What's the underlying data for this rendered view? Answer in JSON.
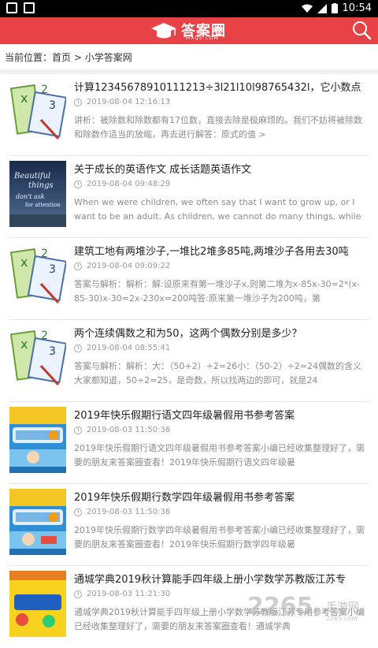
{
  "status_bar": {
    "time": "10:54",
    "icons": [
      "square-icon",
      "image-icon",
      "wifi-icon",
      "signal-icon",
      "battery-icon"
    ]
  },
  "header": {
    "logo_text": "答案圈",
    "logo_domain": "MXQE.COM",
    "search_icon": "search-icon",
    "accent_color": "#e84246"
  },
  "breadcrumb": {
    "prefix": "当前位置：",
    "home": "首页",
    "separator": " > ",
    "current": "小学答案网"
  },
  "items": [
    {
      "title": "计算12345678910111213÷3l21l10l98765432l，它小数点",
      "time": "2019-08-04 12:16:13",
      "desc": "讲析：被除数和除数都有17位数，直接去除是极麻烦的。我们不妨将被除数和除数作适当的放缩，再去进行解答：原式的值 >",
      "thumb": "math-notebook"
    },
    {
      "title": "关于成长的英语作文 成长话题英语作文",
      "time": "2019-08-04 09:48:29",
      "desc": "When we were children, we often say that I want to grow up, or I want to be an adult. As children, we cannot do many things, while",
      "thumb": "beautiful-things"
    },
    {
      "title": "建筑工地有两堆沙子,一堆比2堆多85吨,两堆沙子各用去30吨",
      "time": "2019-08-04 09:09:22",
      "desc": "答案与解析：解析：解:设原来有第一堆沙子x,则第二堆为x-85x-30=2*(x-85-30)x-30=2x-230x=200吨答:原来第一堆沙子为200吨，第",
      "thumb": "math-notebook"
    },
    {
      "title": "两个连续偶数之和为50，这两个偶数分别是多少？",
      "time": "2019-08-04 08:55:41",
      "desc": "答案与解析：解析：大：（50+2）÷2=26小：（50-2）÷2=24偶数的含义大家都知道，50÷2=25，是奇数，所以找两边的即可，就是24",
      "thumb": "math-notebook"
    },
    {
      "title": "2019年快乐假期行语文四年级暑假用书参考答案",
      "time": "2019-08-03 11:50:36",
      "desc": "2019年快乐假期行语文四年级暑假用书参考答案小编已经收集整理好了，需要的朋友来答案圈查看！2019年快乐假期行语文四年级暑",
      "thumb": "holiday-book"
    },
    {
      "title": "2019年快乐假期行数学四年级暑假用书参考答案",
      "time": "2019-08-03 11:50:36",
      "desc": "2019年快乐假期行数学四年级暑假用书参考答案小编已经收集整理好了，需要的朋友来答案圈查看！2019年快乐假期行数学四年级暑",
      "thumb": "holiday-book"
    },
    {
      "title": "通城学典2019秋计算能手四年级上册小学数学苏教版江苏专",
      "time": "2019-08-03 11:21:30",
      "desc": "通城学典2019秋计算能手四年级上册小学数学苏教版江苏专用参考答案小编已经收集整理好了，需要的朋友来答案圈查看！通城学典",
      "thumb": "calc-book"
    }
  ],
  "watermark": {
    "big": "2265",
    "small": "手游网",
    "url": "2265.com"
  }
}
